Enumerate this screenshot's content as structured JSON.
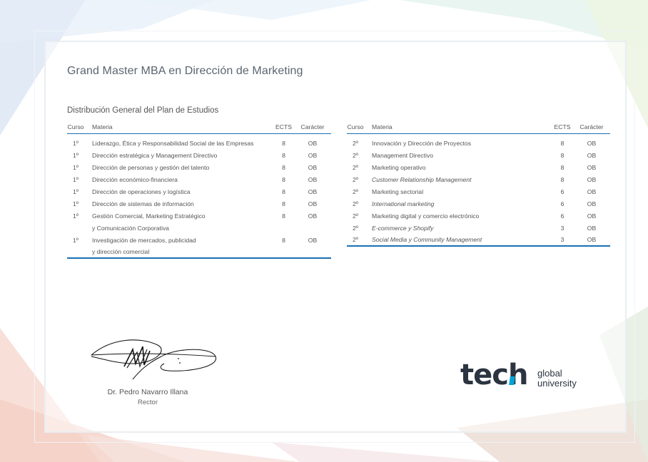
{
  "document": {
    "title": "Grand Master MBA en Dirección de Marketing",
    "subtitle": "Distribución General del Plan de Estudios"
  },
  "table_headers": {
    "curso": "Curso",
    "materia": "Materia",
    "ects": "ECTS",
    "caracter": "Carácter"
  },
  "left_rows": [
    {
      "curso": "1º",
      "materia": "Liderazgo, Ética y Responsabilidad Social de las Empresas",
      "ects": "8",
      "caracter": "OB"
    },
    {
      "curso": "1º",
      "materia": "Dirección estratégica y Management Directivo",
      "ects": "8",
      "caracter": "OB"
    },
    {
      "curso": "1º",
      "materia": "Dirección de personas y gestión del talento",
      "ects": "8",
      "caracter": "OB"
    },
    {
      "curso": "1º",
      "materia": "Dirección económico-financiera",
      "ects": "8",
      "caracter": "OB"
    },
    {
      "curso": "1º",
      "materia": "Dirección de operaciones y logística",
      "ects": "8",
      "caracter": "OB"
    },
    {
      "curso": "1º",
      "materia": "Dirección de sistemas de información",
      "ects": "8",
      "caracter": "OB"
    },
    {
      "curso": "1º",
      "materia": "Gestión Comercial, Marketing Estratégico",
      "ects": "8",
      "caracter": "OB"
    },
    {
      "curso": "",
      "materia": "y Comunicación Corporativa",
      "ects": "",
      "caracter": ""
    },
    {
      "curso": "1º",
      "materia": "Investigación de mercados, publicidad",
      "ects": "8",
      "caracter": "OB"
    },
    {
      "curso": "",
      "materia": "y dirección comercial",
      "ects": "",
      "caracter": ""
    }
  ],
  "right_rows": [
    {
      "curso": "2º",
      "materia": "Innovación y Dirección de Proyectos",
      "ects": "8",
      "caracter": "OB"
    },
    {
      "curso": "2º",
      "materia": "Management Directivo",
      "ects": "8",
      "caracter": "OB"
    },
    {
      "curso": "2º",
      "materia": " Marketing operativo",
      "ects": "8",
      "caracter": "OB"
    },
    {
      "curso": "2º",
      "materia": "Customer Relationship Management",
      "ects": "8",
      "caracter": "OB"
    },
    {
      "curso": "2º",
      "materia": "Marketing sectorial",
      "ects": "6",
      "caracter": "OB"
    },
    {
      "curso": "2º",
      "materia": "International marketing",
      "ects": "6",
      "caracter": "OB"
    },
    {
      "curso": "2º",
      "materia": "Marketing digital y comercio electrónico",
      "ects": "6",
      "caracter": "OB"
    },
    {
      "curso": "2º",
      "materia": "E-commerce y Shopify",
      "ects": "3",
      "caracter": "OB"
    },
    {
      "curso": "2º",
      "materia": "Social Media y Community Management",
      "ects": "3",
      "caracter": "OB"
    }
  ],
  "signature": {
    "name": "Dr. Pedro Navarro Illana",
    "role": "Rector"
  },
  "logo": {
    "brand": "tech",
    "line1": "global",
    "line2": "university",
    "accent_color": "#00a3d9",
    "text_color": "#2b3440"
  },
  "colors": {
    "rule_blue": "#1a6fb0"
  }
}
